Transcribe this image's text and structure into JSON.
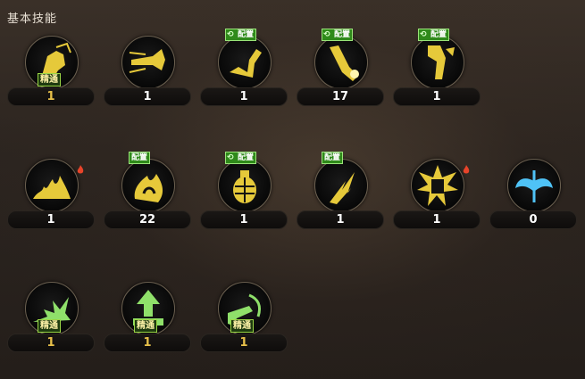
{
  "panel": {
    "title": "基本技能"
  },
  "rows": [
    [
      {
        "name": "skill-1-1",
        "count": "1",
        "tag": "精通",
        "config": null,
        "flame": false,
        "color": "#e6c93a",
        "glyph": "fist"
      },
      {
        "name": "skill-1-2",
        "count": "1",
        "tag": null,
        "config": null,
        "flame": false,
        "color": "#e6c93a",
        "glyph": "dash"
      },
      {
        "name": "skill-1-3",
        "count": "1",
        "tag": null,
        "config": "配置",
        "cycle": true,
        "flame": false,
        "color": "#e6c93a",
        "glyph": "kick"
      },
      {
        "name": "skill-1-4",
        "count": "17",
        "tag": null,
        "config": "配置",
        "cycle": true,
        "flame": false,
        "color": "#e6c93a",
        "glyph": "strike"
      },
      {
        "name": "skill-1-5",
        "count": "1",
        "tag": null,
        "config": "配置",
        "cycle": true,
        "flame": false,
        "color": "#e6c93a",
        "glyph": "leg"
      }
    ],
    [
      {
        "name": "skill-2-1",
        "count": "1",
        "tag": null,
        "config": null,
        "flame": true,
        "color": "#e6c93a",
        "glyph": "fire"
      },
      {
        "name": "skill-2-2",
        "count": "22",
        "tag": null,
        "config": "配置",
        "cycle": false,
        "flame": false,
        "color": "#e6c93a",
        "glyph": "blaze"
      },
      {
        "name": "skill-2-3",
        "count": "1",
        "tag": null,
        "config": "配置",
        "cycle": true,
        "flame": false,
        "color": "#e6c93a",
        "glyph": "grenade"
      },
      {
        "name": "skill-2-4",
        "count": "1",
        "tag": null,
        "config": "配置",
        "cycle": false,
        "flame": false,
        "color": "#e6c93a",
        "glyph": "slash"
      },
      {
        "name": "skill-2-5",
        "count": "1",
        "tag": null,
        "config": null,
        "flame": true,
        "color": "#e6c93a",
        "glyph": "burst"
      },
      {
        "name": "skill-2-6",
        "count": "0",
        "tag": null,
        "config": null,
        "flame": false,
        "color": "#4fc3f7",
        "glyph": "wing"
      }
    ],
    [
      {
        "name": "skill-3-1",
        "count": "1",
        "tag": "精通",
        "config": null,
        "flame": false,
        "color": "#8fe06a",
        "glyph": "spike"
      },
      {
        "name": "skill-3-2",
        "count": "1",
        "tag": "精通",
        "config": null,
        "flame": false,
        "color": "#8fe06a",
        "glyph": "up"
      },
      {
        "name": "skill-3-3",
        "count": "1",
        "tag": "精通",
        "config": null,
        "flame": false,
        "color": "#8fe06a",
        "glyph": "gun"
      }
    ]
  ]
}
